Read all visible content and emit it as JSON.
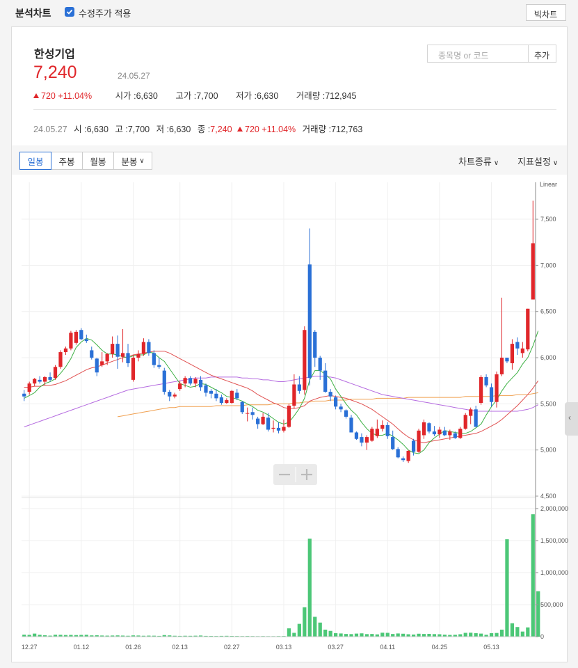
{
  "header": {
    "title": "분석차트",
    "adjusted_price_label": "수정주가 적용",
    "adjusted_price_checked": true,
    "big_chart_label": "빅차트"
  },
  "stock": {
    "name": "한성기업",
    "price": "7,240",
    "date": "24.05.27",
    "change": "720",
    "change_pct": "+11.04%",
    "open_label": "시가 :",
    "open": "6,630",
    "high_label": "고가 :",
    "high": "7,700",
    "low_label": "저가 :",
    "low": "6,630",
    "volume_label": "거래량 :",
    "volume": "712,945"
  },
  "search": {
    "placeholder": "종목명 or 코드",
    "add_label": "추가"
  },
  "ohlc_row": {
    "date": "24.05.27",
    "open_label": "시 :",
    "open": "6,630",
    "high_label": "고 :",
    "high": "7,700",
    "low_label": "저 :",
    "low": "6,630",
    "close_label": "종 :",
    "close": "7,240",
    "change": "720",
    "change_pct": "+11.04%",
    "volume_label": "거래량 :",
    "volume": "712,763"
  },
  "toolbar": {
    "tabs": [
      "일봉",
      "주봉",
      "월봉",
      "분봉"
    ],
    "active_tab": 0,
    "chart_type_label": "차트종류",
    "indicator_label": "지표설정"
  },
  "colors": {
    "up": "#e0262a",
    "down": "#2a70d6",
    "ma5": "#3cb043",
    "ma20": "#e05050",
    "ma60": "#b56be0",
    "ma120": "#f0a050",
    "volume": "#4cc777"
  },
  "chart_data": {
    "type": "candlestick",
    "scale_label": "Linear",
    "price_ticks": [
      4500,
      5000,
      5500,
      6000,
      6500,
      7000,
      7500
    ],
    "price_tick_labels": [
      "4,500",
      "5,000",
      "5,500",
      "6,000",
      "6,500",
      "7,000",
      "7,500"
    ],
    "price_range": [
      4500,
      7900
    ],
    "volume_ticks": [
      0,
      500000,
      1000000,
      1500000,
      2000000
    ],
    "volume_tick_labels": [
      "0",
      "500,000",
      "1,000,000",
      "1,500,000",
      "2,000,000"
    ],
    "volume_range": [
      0,
      2150000
    ],
    "x_tick_labels": [
      {
        "label": "12.27",
        "index": 1
      },
      {
        "label": "01.12",
        "index": 11
      },
      {
        "label": "01.26",
        "index": 21
      },
      {
        "label": "02.13",
        "index": 30
      },
      {
        "label": "02.27",
        "index": 40
      },
      {
        "label": "03.13",
        "index": 50
      },
      {
        "label": "03.27",
        "index": 60
      },
      {
        "label": "04.11",
        "index": 70
      },
      {
        "label": "04.25",
        "index": 80
      },
      {
        "label": "05.13",
        "index": 90
      }
    ],
    "candles": [
      [
        5610,
        5650,
        5530,
        5580
      ],
      [
        5630,
        5740,
        5600,
        5720
      ],
      [
        5720,
        5780,
        5690,
        5770
      ],
      [
        5760,
        5800,
        5720,
        5740
      ],
      [
        5740,
        5800,
        5700,
        5790
      ],
      [
        5790,
        5840,
        5740,
        5760
      ],
      [
        5780,
        5920,
        5760,
        5900
      ],
      [
        5900,
        6080,
        5880,
        6060
      ],
      [
        6060,
        6120,
        6030,
        6100
      ],
      [
        6100,
        6290,
        6080,
        6270
      ],
      [
        6160,
        6300,
        6140,
        6280
      ],
      [
        6300,
        6320,
        6190,
        6200
      ],
      [
        6200,
        6250,
        6160,
        6180
      ],
      [
        6080,
        6120,
        5980,
        6000
      ],
      [
        5990,
        6000,
        5800,
        5840
      ],
      [
        5920,
        6060,
        5900,
        5960
      ],
      [
        5960,
        6050,
        5920,
        6040
      ],
      [
        6040,
        6230,
        6000,
        6150
      ],
      [
        6150,
        6240,
        5880,
        6010
      ],
      [
        6010,
        6310,
        5950,
        6050
      ],
      [
        6050,
        6150,
        5900,
        5940
      ],
      [
        5760,
        6030,
        5740,
        6000
      ],
      [
        6000,
        6080,
        5960,
        6040
      ],
      [
        6040,
        6210,
        6020,
        6170
      ],
      [
        6170,
        6200,
        6020,
        6050
      ],
      [
        6050,
        6080,
        5890,
        5920
      ],
      [
        5920,
        6000,
        5880,
        5900
      ],
      [
        5860,
        5890,
        5600,
        5630
      ],
      [
        5630,
        5650,
        5530,
        5580
      ],
      [
        5580,
        5620,
        5560,
        5600
      ],
      [
        5660,
        5750,
        5640,
        5720
      ],
      [
        5720,
        5800,
        5680,
        5780
      ],
      [
        5780,
        5800,
        5700,
        5720
      ],
      [
        5720,
        5790,
        5680,
        5770
      ],
      [
        5760,
        5800,
        5640,
        5680
      ],
      [
        5700,
        5720,
        5580,
        5620
      ],
      [
        5640,
        5660,
        5560,
        5610
      ],
      [
        5610,
        5660,
        5530,
        5560
      ],
      [
        5570,
        5600,
        5490,
        5510
      ],
      [
        5510,
        5560,
        5500,
        5540
      ],
      [
        5510,
        5650,
        5500,
        5640
      ],
      [
        5620,
        5660,
        5540,
        5560
      ],
      [
        5520,
        5530,
        5390,
        5410
      ],
      [
        5400,
        5460,
        5310,
        5400
      ],
      [
        5410,
        5460,
        5330,
        5380
      ],
      [
        5340,
        5360,
        5230,
        5280
      ],
      [
        5280,
        5400,
        5270,
        5360
      ],
      [
        5350,
        5400,
        5200,
        5220
      ],
      [
        5230,
        5320,
        5190,
        5240
      ],
      [
        5240,
        5300,
        5180,
        5210
      ],
      [
        5210,
        5330,
        5190,
        5250
      ],
      [
        5250,
        5500,
        5240,
        5480
      ],
      [
        5480,
        5820,
        5450,
        5710
      ],
      [
        5710,
        5800,
        5610,
        5640
      ],
      [
        5650,
        6340,
        5600,
        6300
      ],
      [
        7010,
        7400,
        5700,
        5780
      ],
      [
        6280,
        6300,
        5900,
        6000
      ],
      [
        6000,
        6020,
        5760,
        5860
      ],
      [
        5860,
        5940,
        5620,
        5630
      ],
      [
        5630,
        5660,
        5530,
        5580
      ],
      [
        5570,
        5590,
        5440,
        5470
      ],
      [
        5470,
        5500,
        5410,
        5440
      ],
      [
        5430,
        5440,
        5340,
        5360
      ],
      [
        5350,
        5380,
        5190,
        5190
      ],
      [
        5190,
        5200,
        5110,
        5120
      ],
      [
        5140,
        5180,
        5040,
        5080
      ],
      [
        5080,
        5160,
        5000,
        5140
      ],
      [
        5100,
        5250,
        5090,
        5230
      ],
      [
        5150,
        5330,
        5130,
        5230
      ],
      [
        5230,
        5320,
        5200,
        5270
      ],
      [
        5270,
        5300,
        5120,
        5150
      ],
      [
        5140,
        5210,
        5000,
        5010
      ],
      [
        5010,
        5030,
        4910,
        4920
      ],
      [
        4910,
        4930,
        4870,
        4890
      ],
      [
        4880,
        5000,
        4860,
        4990
      ],
      [
        5100,
        5120,
        4940,
        4980
      ],
      [
        4980,
        5230,
        4970,
        5210
      ],
      [
        5160,
        5330,
        5120,
        5300
      ],
      [
        5290,
        5300,
        5180,
        5200
      ],
      [
        5200,
        5260,
        5150,
        5170
      ],
      [
        5170,
        5250,
        5130,
        5220
      ],
      [
        5210,
        5250,
        5150,
        5160
      ],
      [
        5160,
        5220,
        5110,
        5200
      ],
      [
        5180,
        5200,
        5120,
        5130
      ],
      [
        5130,
        5250,
        5120,
        5230
      ],
      [
        5230,
        5400,
        5220,
        5380
      ],
      [
        5370,
        5460,
        5280,
        5440
      ],
      [
        5440,
        5480,
        5250,
        5250
      ],
      [
        5510,
        5810,
        5490,
        5790
      ],
      [
        5790,
        5820,
        5680,
        5700
      ],
      [
        5680,
        5720,
        5470,
        5520
      ],
      [
        5520,
        5850,
        5460,
        5820
      ],
      [
        5820,
        6650,
        5800,
        6000
      ],
      [
        6000,
        6000,
        5940,
        5960
      ],
      [
        5940,
        6200,
        5870,
        6150
      ],
      [
        6170,
        6220,
        6030,
        6100
      ],
      [
        6050,
        6170,
        6000,
        6100
      ],
      [
        6090,
        6530,
        6070,
        6530
      ],
      [
        6630,
        7700,
        6630,
        7240
      ]
    ],
    "volumes": [
      32000,
      29000,
      48000,
      30000,
      22000,
      16000,
      31000,
      30000,
      26000,
      28000,
      25000,
      28000,
      30000,
      20000,
      22000,
      18000,
      16000,
      18000,
      20000,
      17000,
      14000,
      20000,
      18000,
      14000,
      16000,
      15000,
      12000,
      25000,
      20000,
      14000,
      12000,
      14000,
      13000,
      15000,
      18000,
      12000,
      11000,
      10000,
      12000,
      13000,
      11000,
      10000,
      9000,
      10000,
      9000,
      8000,
      9000,
      8000,
      8000,
      9000,
      10000,
      130000,
      60000,
      200000,
      460000,
      1530000,
      310000,
      220000,
      110000,
      90000,
      55000,
      50000,
      42000,
      40000,
      48000,
      52000,
      40000,
      42000,
      36000,
      62000,
      60000,
      42000,
      50000,
      46000,
      38000,
      34000,
      46000,
      42000,
      44000,
      40000,
      38000,
      32000,
      28000,
      30000,
      38000,
      60000,
      62000,
      55000,
      48000,
      30000,
      55000,
      58000,
      110000,
      1520000,
      210000,
      150000,
      80000,
      145000,
      1910000,
      710000
    ],
    "moving_averages": {
      "ma5": [
        5560,
        5590,
        5620,
        5680,
        5720,
        5740,
        5770,
        5830,
        5900,
        5990,
        6110,
        6170,
        6210,
        6190,
        6140,
        6080,
        6040,
        6040,
        6030,
        6010,
        6000,
        6020,
        6030,
        6030,
        6060,
        6050,
        6000,
        5960,
        5880,
        5800,
        5720,
        5700,
        5680,
        5690,
        5720,
        5710,
        5680,
        5650,
        5620,
        5580,
        5570,
        5550,
        5530,
        5500,
        5470,
        5430,
        5410,
        5380,
        5340,
        5300,
        5280,
        5300,
        5370,
        5450,
        5560,
        5760,
        5860,
        5860,
        5820,
        5770,
        5660,
        5580,
        5500,
        5430,
        5380,
        5300,
        5230,
        5180,
        5160,
        5160,
        5180,
        5150,
        5110,
        5060,
        5000,
        4970,
        4960,
        5000,
        5080,
        5130,
        5170,
        5210,
        5200,
        5190,
        5180,
        5180,
        5200,
        5240,
        5280,
        5380,
        5470,
        5540,
        5640,
        5720,
        5780,
        5840,
        5930,
        6000,
        6130,
        6290
      ],
      "ma20": [
        5680,
        5680,
        5690,
        5690,
        5700,
        5700,
        5710,
        5730,
        5750,
        5780,
        5810,
        5840,
        5870,
        5890,
        5900,
        5920,
        5940,
        5960,
        5980,
        6000,
        6010,
        6030,
        6040,
        6050,
        6060,
        6070,
        6070,
        6070,
        6050,
        6020,
        5990,
        5960,
        5930,
        5900,
        5870,
        5840,
        5810,
        5790,
        5770,
        5750,
        5730,
        5710,
        5690,
        5670,
        5640,
        5600,
        5570,
        5540,
        5510,
        5490,
        5460,
        5450,
        5450,
        5460,
        5480,
        5530,
        5550,
        5570,
        5580,
        5590,
        5580,
        5570,
        5560,
        5540,
        5520,
        5500,
        5470,
        5440,
        5400,
        5360,
        5320,
        5280,
        5230,
        5180,
        5140,
        5110,
        5090,
        5080,
        5090,
        5100,
        5110,
        5120,
        5130,
        5140,
        5150,
        5160,
        5170,
        5180,
        5200,
        5230,
        5260,
        5290,
        5330,
        5380,
        5430,
        5480,
        5540,
        5600,
        5670,
        5750
      ],
      "ma60": [
        5250,
        5270,
        5290,
        5310,
        5330,
        5350,
        5370,
        5390,
        5410,
        5430,
        5450,
        5470,
        5490,
        5510,
        5530,
        5550,
        5570,
        5590,
        5610,
        5630,
        5650,
        5660,
        5670,
        5680,
        5690,
        5700,
        5710,
        5720,
        5730,
        5740,
        5750,
        5760,
        5770,
        5780,
        5780,
        5780,
        5790,
        5790,
        5790,
        5790,
        5790,
        5790,
        5780,
        5780,
        5770,
        5770,
        5760,
        5760,
        5750,
        5740,
        5740,
        5750,
        5760,
        5770,
        5780,
        5790,
        5800,
        5800,
        5800,
        5790,
        5780,
        5760,
        5740,
        5720,
        5700,
        5680,
        5660,
        5640,
        5620,
        5600,
        5590,
        5580,
        5570,
        5560,
        5550,
        5540,
        5530,
        5520,
        5510,
        5500,
        5490,
        5480,
        5470,
        5460,
        5450,
        5440,
        5430,
        5420,
        5420,
        5420,
        5420,
        5420,
        5420,
        5420,
        5420,
        5420,
        5430,
        5440,
        5460,
        5490
      ],
      "ma120": [
        null,
        null,
        null,
        null,
        null,
        null,
        null,
        null,
        null,
        null,
        null,
        null,
        null,
        null,
        null,
        null,
        null,
        null,
        5360,
        5370,
        5380,
        5390,
        5400,
        5410,
        5420,
        5430,
        5440,
        5450,
        5460,
        5460,
        5470,
        5470,
        5470,
        5470,
        5470,
        5470,
        5470,
        5480,
        5480,
        5480,
        5480,
        5480,
        5480,
        5490,
        5490,
        5490,
        5490,
        5490,
        5500,
        5500,
        5500,
        5500,
        5510,
        5510,
        5520,
        5520,
        5530,
        5530,
        5530,
        5540,
        5540,
        5540,
        5540,
        5550,
        5550,
        5550,
        5550,
        5550,
        5560,
        5560,
        5560,
        5560,
        5560,
        5560,
        5570,
        5570,
        5570,
        5570,
        5570,
        5570,
        5570,
        5570,
        5570,
        5570,
        5570,
        5580,
        5580,
        5580,
        5580,
        5580,
        5580,
        5590,
        5590,
        5590,
        5590,
        5600,
        5600,
        5600,
        5610,
        5620
      ]
    }
  }
}
